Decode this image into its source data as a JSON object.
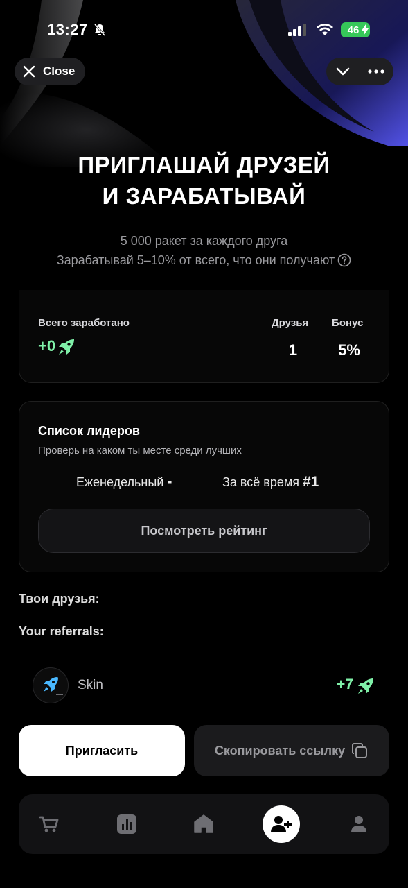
{
  "status_bar": {
    "time": "13:27",
    "battery": "46"
  },
  "top_bar": {
    "close_label": "Close"
  },
  "hero": {
    "title_line1": "ПРИГЛАШАЙ ДРУЗЕЙ",
    "title_line2": "И ЗАРАБАТЫВАЙ",
    "subtitle_line1": "5 000 ракет за каждого друга",
    "subtitle_line2": "Зарабатывай 5–10% от всего, что они получают"
  },
  "stats": {
    "earned_label": "Всего заработано",
    "earned_value": "+0",
    "friends_label": "Друзья",
    "friends_value": "1",
    "bonus_label": "Бонус",
    "bonus_value": "5%"
  },
  "leaderboard": {
    "title": "Список лидеров",
    "subtitle": "Проверь на каком ты месте среди лучших",
    "weekly_label": "Еженедельный",
    "weekly_value": "-",
    "alltime_label": "За всё время",
    "alltime_value": "#1",
    "button_label": "Посмотреть рейтинг"
  },
  "friends": {
    "friends_heading": "Твои друзья:",
    "referrals_heading": "Your referrals:",
    "items": [
      {
        "name": "Skin",
        "bonus": "+7"
      }
    ]
  },
  "actions": {
    "invite_label": "Пригласить",
    "copy_label": "Скопировать ссылку"
  },
  "tab_bar": {
    "tabs": [
      {
        "icon": "cart-icon"
      },
      {
        "icon": "stats-icon"
      },
      {
        "icon": "home-icon"
      },
      {
        "icon": "add-friend-icon",
        "active": true
      },
      {
        "icon": "profile-icon"
      }
    ]
  },
  "colors": {
    "accent_green": "#7ff0a8",
    "background": "#000000",
    "battery_green": "#36c759"
  }
}
